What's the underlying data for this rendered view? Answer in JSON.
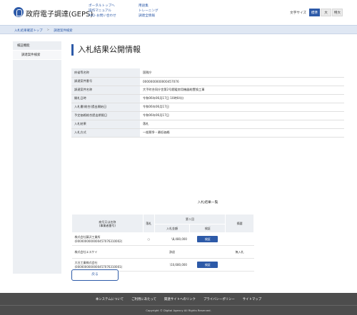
{
  "header": {
    "site_title": "政府電子調達(GEPS)",
    "links_col1": [
      "ポータルトップへ",
      "操作マニュアル",
      "FAQ･お問い合わせ"
    ],
    "links_col2": [
      "用語集",
      "トレーニング",
      "調達全情報"
    ],
    "font_size_label": "文字サイズ",
    "font_size_options": [
      "標準",
      "大",
      "特大"
    ],
    "font_size_selected": "標準"
  },
  "breadcrumb": [
    "入札結果確認トップ",
    "調達案件検索"
  ],
  "sidebar": {
    "items": [
      "検証機能",
      "調達案件検索"
    ]
  },
  "page_title": "入札結果公開情報",
  "info": [
    {
      "label": "府省等名称",
      "value": "国税庁"
    },
    {
      "label": "調達案件番号",
      "value": "0000000000000457076"
    },
    {
      "label": "調達案件名称",
      "value": "大手町合同庁舎第2号館暖房用機器総置換工事"
    },
    {
      "label": "開札日時",
      "value": "令和06年06月17日 10時04分"
    },
    {
      "label": "入札書(総合)提出開始日",
      "value": "令和06年06月17日"
    },
    {
      "label": "予定価格総合提出期限日",
      "value": "令和06年06月17日"
    },
    {
      "label": "入札結果",
      "value": "落札"
    },
    {
      "label": "入札方式",
      "value": "一般競争・最低価格"
    }
  ],
  "results_title": "入札結果一覧",
  "results_headers": {
    "bidder": "商号又は名称\n(事業者番号)",
    "award": "落札",
    "round": "第１回",
    "amount": "入札金額",
    "verify": "検証",
    "remarks": "摘要"
  },
  "results_rows": [
    {
      "name": "株式会社藤沢工業所",
      "id": "(0000000000000457076310002)",
      "award": "○",
      "amount": "\\8,480,000",
      "verify": "検証",
      "remarks": ""
    },
    {
      "name": "株式会社エスケイ",
      "id": "",
      "award": "",
      "amount": "辞退",
      "verify": "",
      "remarks": "無入札"
    },
    {
      "name": "大谷工業株式会社",
      "id": "(0000000000000457076310001)",
      "award": "",
      "amount": "\\10,680,000",
      "verify": "検証",
      "remarks": ""
    }
  ],
  "back_label": "戻る",
  "footer": {
    "links": [
      "本システムについて",
      "ご利用にあたって",
      "関連サイトへのリンク",
      "プライバシーポリシー",
      "サイトマップ"
    ],
    "copyright": "Copyright © Digital Agency All Rights Reserved."
  },
  "colors": {
    "primary": "#2d5aa8",
    "footer": "#4d4d4d",
    "label_bg": "#eceff3"
  }
}
